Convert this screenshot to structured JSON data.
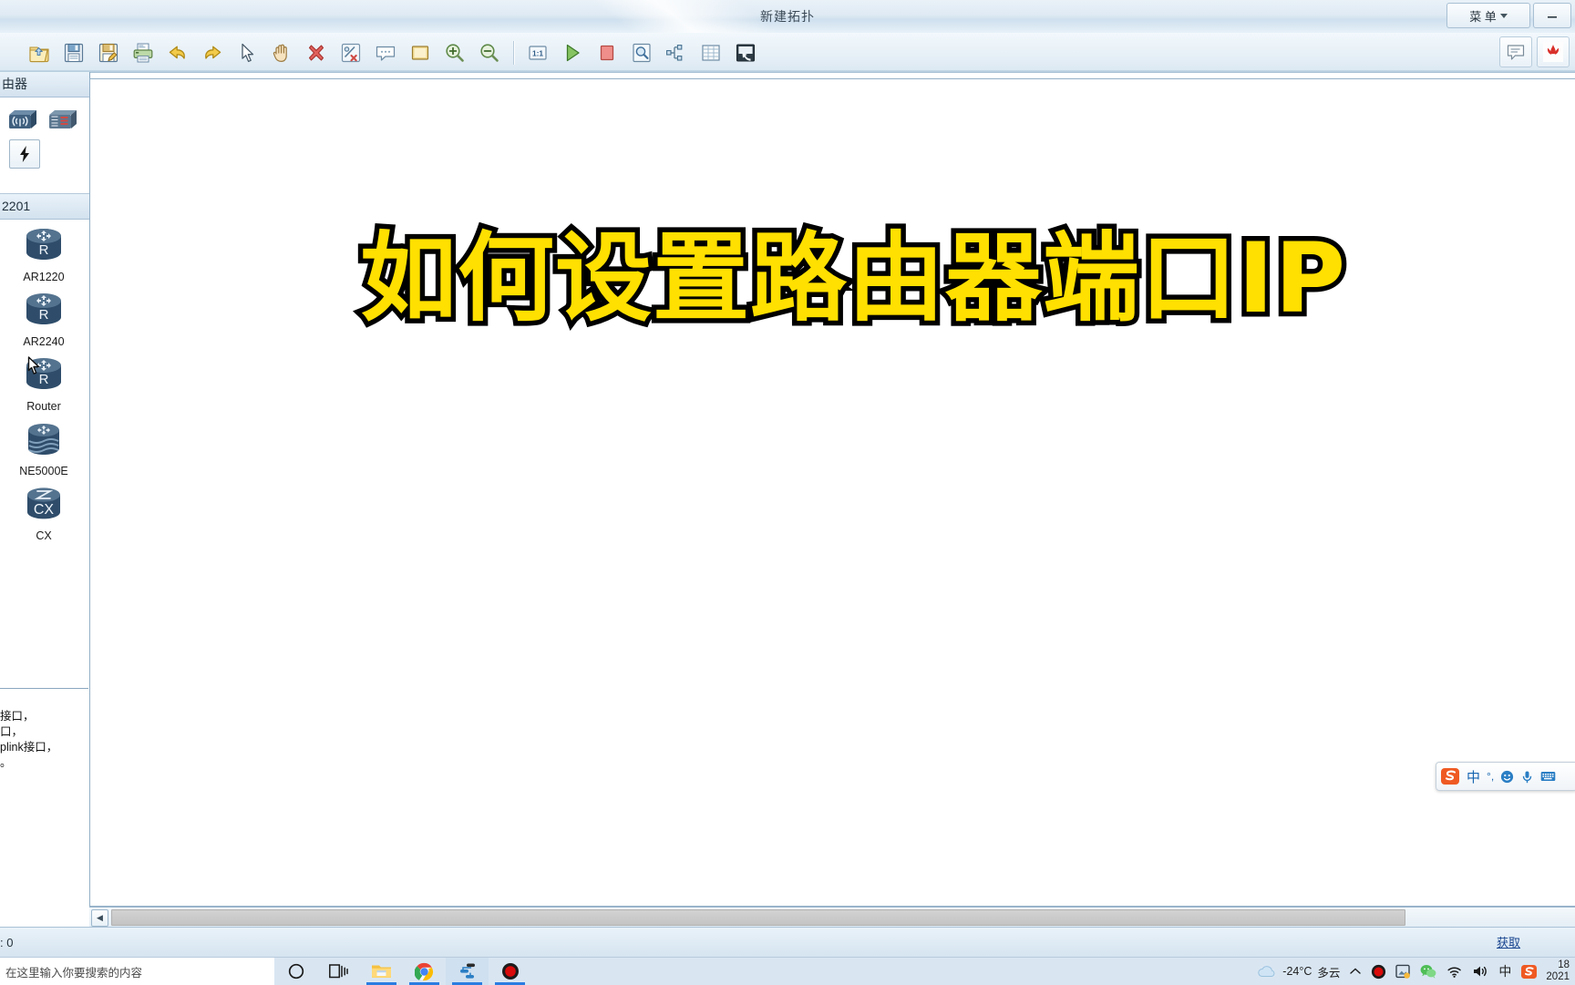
{
  "window": {
    "title": "新建拓扑",
    "menu_label": "菜 单",
    "minimize_label": "—",
    "menu_icon": "chevron-down-icon",
    "chat_icon": "speech-bubble-icon",
    "brand_icon": "huawei-logo-icon"
  },
  "toolbar": {
    "group1": [
      {
        "name": "open-icon",
        "label": "打开"
      },
      {
        "name": "save-icon",
        "label": "保存"
      },
      {
        "name": "save-as-icon",
        "label": "另存为"
      },
      {
        "name": "print-icon",
        "label": "打印"
      },
      {
        "name": "undo-icon",
        "label": "撤销"
      },
      {
        "name": "redo-icon",
        "label": "重做"
      },
      {
        "name": "pointer-icon",
        "label": "选择"
      },
      {
        "name": "hand-icon",
        "label": "移动"
      },
      {
        "name": "delete-icon",
        "label": "删除"
      },
      {
        "name": "delete-link-icon",
        "label": "删除连线"
      },
      {
        "name": "note-icon",
        "label": "添加描述"
      },
      {
        "name": "shape-icon",
        "label": "图形"
      },
      {
        "name": "zoom-in-icon",
        "label": "放大"
      },
      {
        "name": "zoom-out-icon",
        "label": "缩小"
      }
    ],
    "group2": [
      {
        "name": "zoom-reset-icon",
        "label": "1:1"
      },
      {
        "name": "start-device-icon",
        "label": "开启设备"
      },
      {
        "name": "stop-device-icon",
        "label": "关闭设备"
      },
      {
        "name": "capture-icon",
        "label": "数据抓包"
      },
      {
        "name": "topology-tree-icon",
        "label": "拓扑树"
      },
      {
        "name": "grid-icon",
        "label": "网格"
      },
      {
        "name": "restore-icon",
        "label": "还原"
      }
    ]
  },
  "sidebar": {
    "header": "由器",
    "top_icons": [
      {
        "name": "wireless-device-icon",
        "label": "无线设备"
      },
      {
        "name": "device-panel-icon",
        "label": "设备面板"
      },
      {
        "name": "link-device-icon",
        "label": "连线"
      }
    ],
    "category": "2201",
    "devices": [
      {
        "name": "device-ar1220",
        "label": "AR1220",
        "icon": "router-icon"
      },
      {
        "name": "device-ar2240",
        "label": "AR2240",
        "icon": "router-icon"
      },
      {
        "name": "device-router",
        "label": "Router",
        "icon": "router-icon"
      },
      {
        "name": "device-ne5000e",
        "label": "NE5000E",
        "icon": "ne-router-icon"
      },
      {
        "name": "device-cx",
        "label": "CX",
        "icon": "cx-switch-icon"
      }
    ],
    "description_lines": [
      "接口，",
      "口，",
      "plink接口，",
      "。"
    ]
  },
  "canvas": {
    "overlay_title": "如何设置路由器端口IP",
    "overlay_fill_color": "#FFE000",
    "overlay_stroke_color": "#000000",
    "hscroll_left_icon": "chevron-left-icon"
  },
  "statusbar": {
    "left_text": ": 0",
    "right_link": "获取"
  },
  "ime": {
    "logo": "sogou-logo-icon",
    "mode": "中",
    "punct": "°,",
    "emoji_icon": "smiley-icon",
    "mic_icon": "microphone-icon",
    "keyboard_icon": "keyboard-icon"
  },
  "taskbar": {
    "search_placeholder": "在这里输入你要搜索的内容",
    "items": [
      {
        "name": "cortana-icon",
        "label": "Cortana"
      },
      {
        "name": "task-view-icon",
        "label": "任务视图"
      },
      {
        "name": "file-explorer-icon",
        "label": "文件资源管理器"
      },
      {
        "name": "chrome-icon",
        "label": "Google Chrome"
      },
      {
        "name": "ensp-icon",
        "label": "eNSP"
      },
      {
        "name": "recorder-icon",
        "label": "录屏"
      }
    ],
    "tray": {
      "weather_icon": "cloud-icon",
      "temperature": "-24°C",
      "condition": "多云",
      "expand_icon": "chevron-up-icon",
      "icons": [
        {
          "name": "recorder-tray-icon",
          "label": "录屏"
        },
        {
          "name": "screenshot-tray-icon",
          "label": "截图"
        },
        {
          "name": "wechat-tray-icon",
          "label": "微信"
        },
        {
          "name": "wifi-tray-icon",
          "label": "网络"
        },
        {
          "name": "volume-tray-icon",
          "label": "音量"
        },
        {
          "name": "ime-tray-icon",
          "label": "中"
        },
        {
          "name": "sogou-tray-icon",
          "label": "搜狗输入法"
        }
      ],
      "clock_time": "18",
      "clock_date": "2021"
    }
  }
}
